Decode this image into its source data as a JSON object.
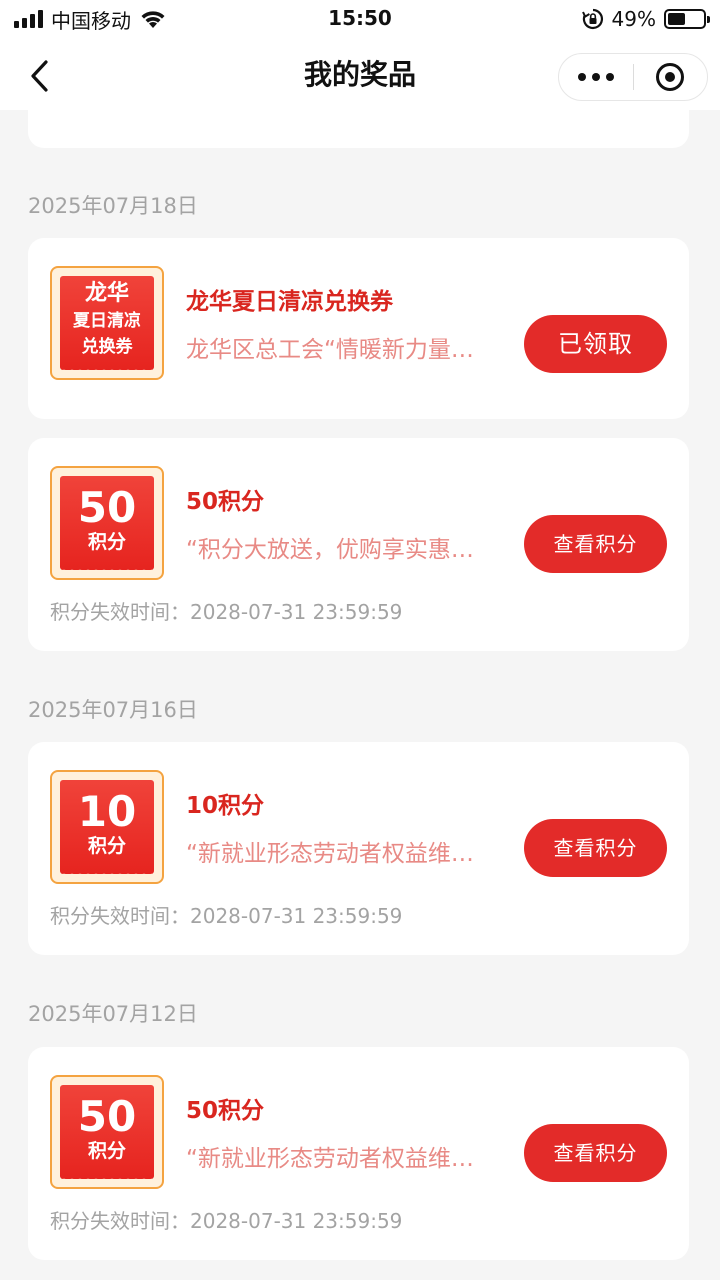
{
  "status_bar": {
    "carrier": "中国移动",
    "time": "15:50",
    "battery_percent": "49%",
    "battery_level": 0.49
  },
  "nav": {
    "title": "我的奖品"
  },
  "groups": [
    {
      "date": "2025年07月18日",
      "cards": [
        {
          "badge_line1": "龙华",
          "badge_line2": "夏日清凉",
          "badge_line3": "兑换券",
          "title": "龙华夏日清凉兑换券",
          "desc": "龙华区总工会“情暖新力量…",
          "action": "已领取"
        },
        {
          "badge_number": "50",
          "badge_unit": "积分",
          "title": "50积分",
          "desc": "“积分大放送，优购享实惠…",
          "action": "查看积分",
          "expire": "积分失效时间：2028-07-31 23:59:59"
        }
      ]
    },
    {
      "date": "2025年07月16日",
      "cards": [
        {
          "badge_number": "10",
          "badge_unit": "积分",
          "title": "10积分",
          "desc": "“新就业形态劳动者权益维…",
          "action": "查看积分",
          "expire": "积分失效时间：2028-07-31 23:59:59"
        }
      ]
    },
    {
      "date": "2025年07月12日",
      "cards": [
        {
          "badge_number": "50",
          "badge_unit": "积分",
          "title": "50积分",
          "desc": "“新就业形态劳动者权益维…",
          "action": "查看积分",
          "expire": "积分失效时间：2028-07-31 23:59:59"
        }
      ]
    }
  ],
  "colors": {
    "accent_red": "#e32b29",
    "title_red": "#d9261f",
    "desc_pink": "#e88a85",
    "badge_border": "#f4a340",
    "page_bg": "#f5f5f5"
  }
}
